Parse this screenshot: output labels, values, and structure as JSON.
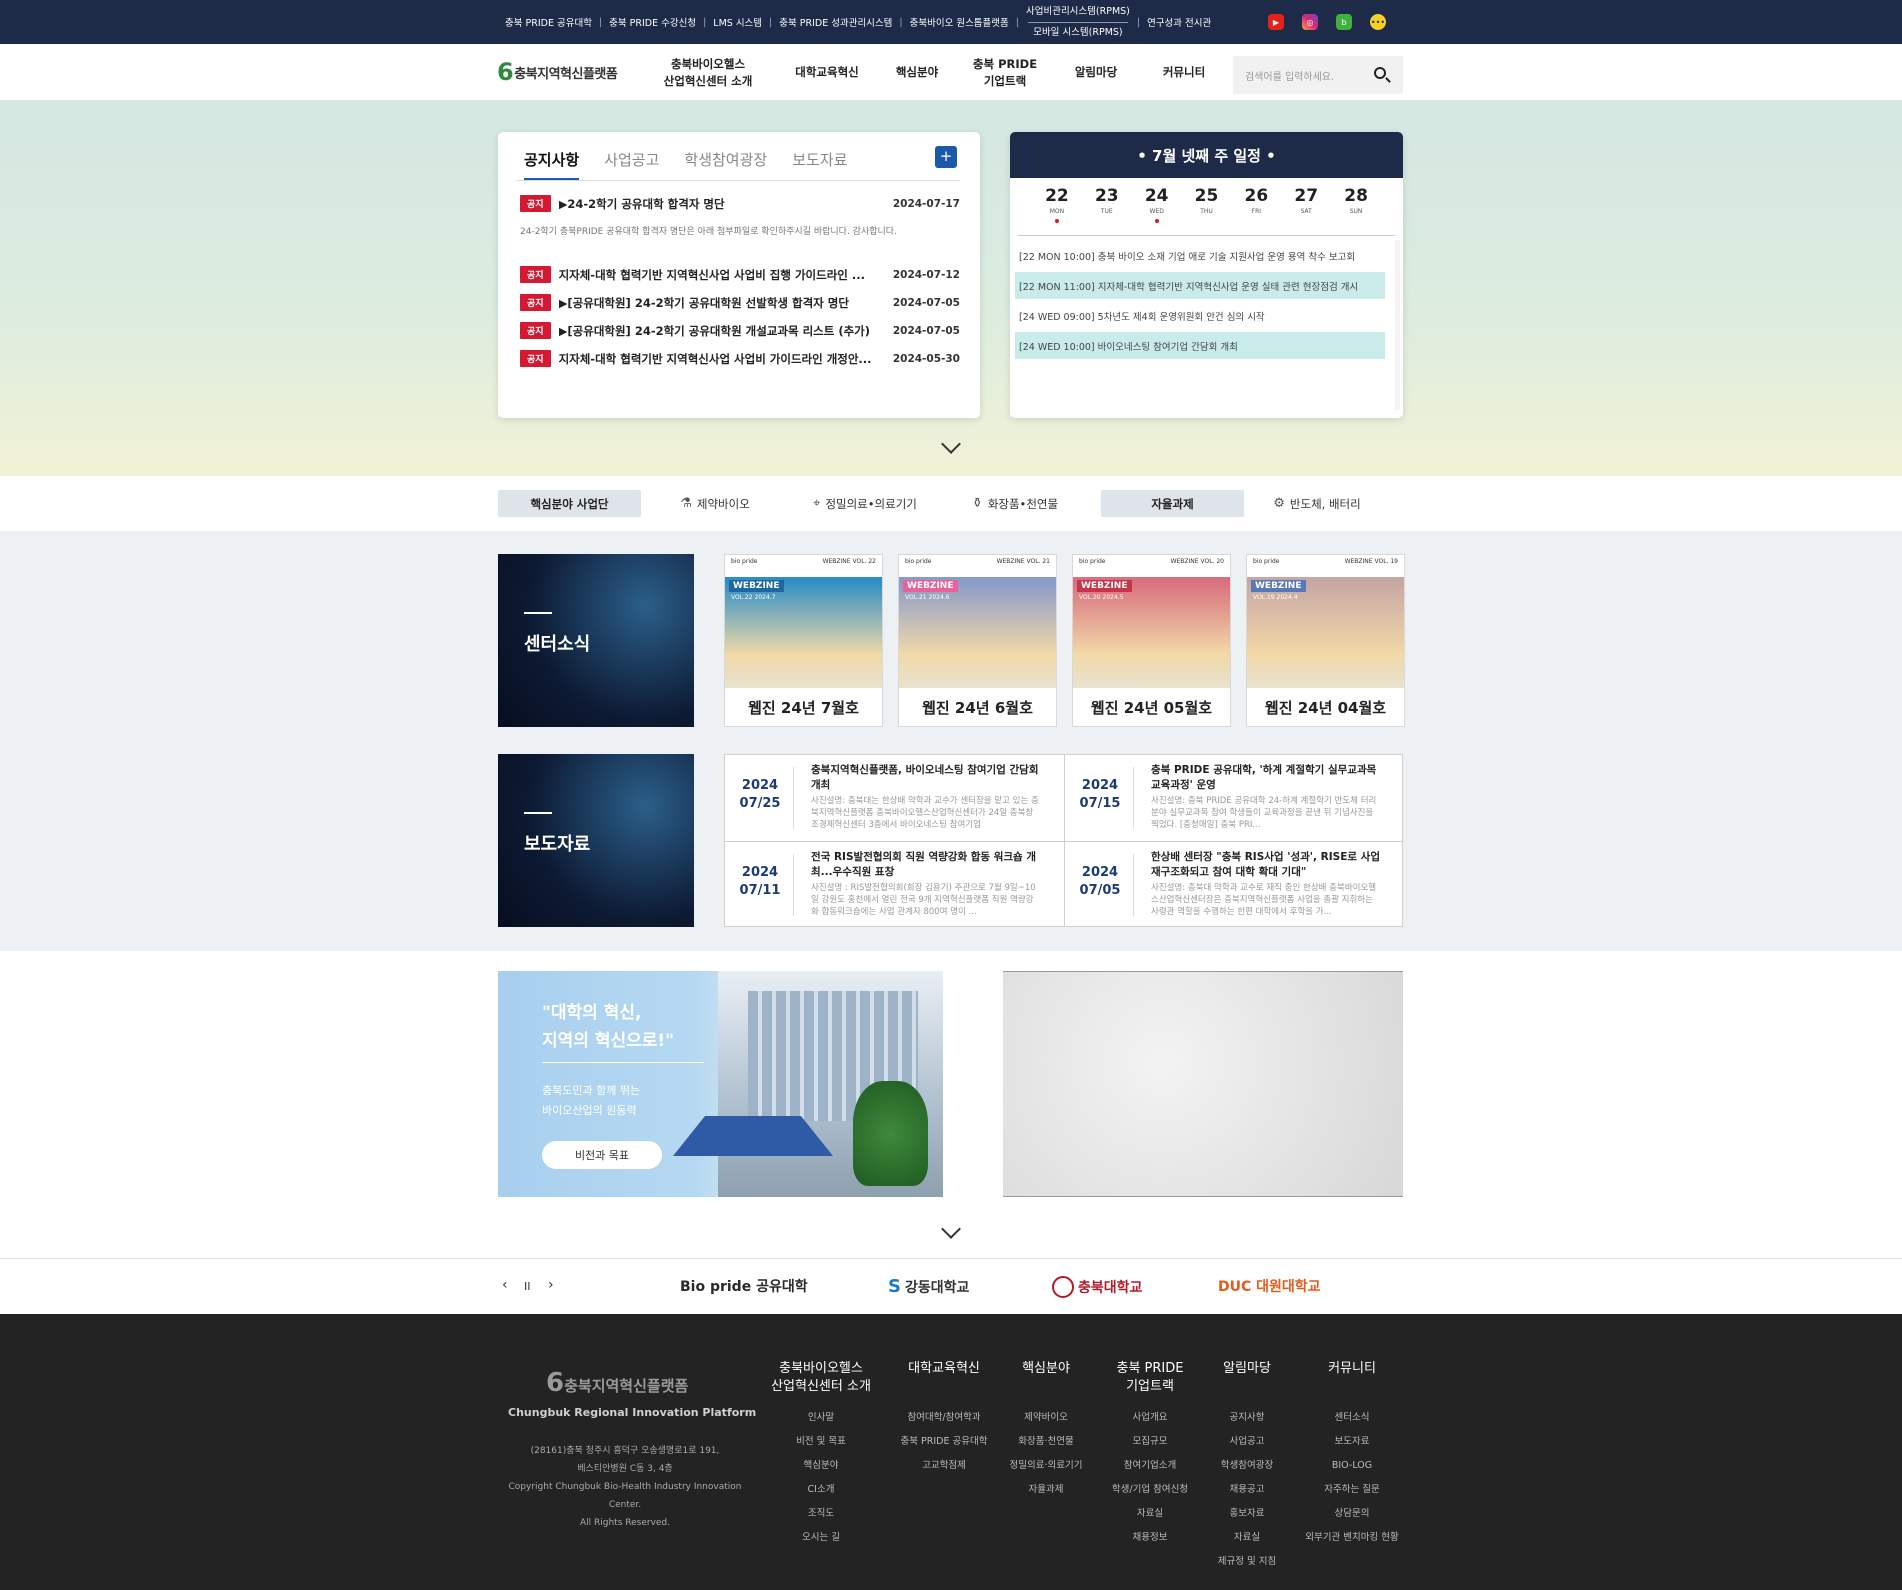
{
  "top_links": {
    "l0": "충북 PRIDE 공유대학",
    "l1": "충북 PRIDE 수강신청",
    "l2": "LMS 시스템",
    "l3": "충북 PRIDE 성과관리시스템",
    "l4": "충북바이오 원스톱플랫폼",
    "l5a": "사업비관리시스템(RPMS)",
    "l5b": "모바일 시스템(RPMS)",
    "l6": "연구성과 전시관"
  },
  "sns_icons": [
    "youtube-icon",
    "instagram-icon",
    "blog-icon",
    "kakao-icon"
  ],
  "logo": "충북지역혁신플랫폼",
  "menu": {
    "m1a": "충북바이오헬스",
    "m1b": "산업혁신센터 소개",
    "m2": "대학교육혁신",
    "m3": "핵심분야",
    "m4a": "충북 PRIDE",
    "m4b": "기업트랙",
    "m5": "알림마당",
    "m6": "커뮤니티"
  },
  "search": {
    "placeholder": "검색어를 입력하세요."
  },
  "notice": {
    "tabs": {
      "t1": "공지사항",
      "t2": "사업공고",
      "t3": "학생참여광장",
      "t4": "보도자료"
    },
    "more": "+",
    "badge": "공지",
    "items": [
      {
        "title": "▶24-2학기 공유대학 합격자 명단",
        "date": "2024-07-17"
      },
      {
        "title": "지자체-대학 협력기반 지역혁신사업 사업비 집행 가이드라인 ...",
        "date": "2024-07-12"
      },
      {
        "title": "▶[공유대학원] 24-2학기 공유대학원 선발학생 합격자 명단",
        "date": "2024-07-05"
      },
      {
        "title": "▶[공유대학원] 24-2학기 공유대학원 개설교과목 리스트 (추가)",
        "date": "2024-07-05"
      },
      {
        "title": "지자체-대학 협력기반 지역혁신사업 사업비 가이드라인 개정안...",
        "date": "2024-05-30"
      }
    ],
    "first_desc": "24-2학기 충북PRIDE 공유대학 합격자 명단은 아래 첨부파일로 확인하주시길 바랍니다. 감사합니다."
  },
  "schedule": {
    "title": "•    7월 넷째 주 일정    •",
    "days": [
      {
        "n": "22",
        "w": "MON",
        "dot": true
      },
      {
        "n": "23",
        "w": "TUE",
        "dot": false
      },
      {
        "n": "24",
        "w": "WED",
        "dot": true
      },
      {
        "n": "25",
        "w": "THU",
        "dot": false
      },
      {
        "n": "26",
        "w": "FRI",
        "dot": false
      },
      {
        "n": "27",
        "w": "SAT",
        "dot": false
      },
      {
        "n": "28",
        "w": "SUN",
        "dot": false
      }
    ],
    "events": [
      {
        "text": "[22 MON 10:00] 충북 바이오 소재 기업 애로 기술 지원사업 운영 용역 착수 보고회",
        "hl": false
      },
      {
        "text": "[22 MON 11:00] 지자체-대학 협력기반 지역혁신사업 운영 실태 관련 현장점검 개시",
        "hl": true
      },
      {
        "text": "[24 WED 09:00] 5차년도 제4회 운영위원회 안건 심의 시작",
        "hl": false
      },
      {
        "text": "[24 WED 10:00] 바이오네스팅 참여기업 간담회 개최",
        "hl": true
      }
    ]
  },
  "biz": {
    "b0": "핵심분야 사업단",
    "b1": "제약바이오",
    "b2": "정밀의료•의료기기",
    "b3": "화장품•천연물",
    "b4": "자율과제",
    "b5": "반도체, 배터리"
  },
  "center_news": "센터소식",
  "press_title": "보도자료",
  "webzines": [
    {
      "caption": "웹진 24년 7월호",
      "tag": "WEBZINE",
      "vol": "VOL.22 2024.7",
      "num": "WEBZINE VOL. 22",
      "color": "#2f8fc4",
      "tagc": "#1f66a5"
    },
    {
      "caption": "웹진 24년 6월호",
      "tag": "WEBZINE",
      "vol": "VOL.21 2024.6",
      "num": "WEBZINE VOL. 21",
      "color": "#8a9bc7",
      "tagc": "#e7629b"
    },
    {
      "caption": "웹진 24년 05월호",
      "tag": "WEBZINE",
      "vol": "VOL.20 2024.5",
      "num": "WEBZINE VOL. 20",
      "color": "#d9707f",
      "tagc": "#c7354d"
    },
    {
      "caption": "웹진 24년 04월호",
      "tag": "WEBZINE",
      "vol": "VOL.19 2024.4",
      "num": "WEBZINE VOL. 19",
      "color": "#c6a7a4",
      "tagc": "#5a78b8"
    }
  ],
  "press": [
    {
      "y": "2024",
      "md": "07/25",
      "title": "충북지역혁신플랫폼, 바이오네스팅 참여기업 간담회 개최",
      "desc": "사진설명: 충북대는 한상배 약학과 교수가 센터장을 맡고 있는 충북지역혁신플랫폼 충북바이오헬스산업혁신센터가 24일 충북창조경제혁신센터 3층에서 바이오네스팅 참여기업"
    },
    {
      "y": "2024",
      "md": "07/15",
      "title": "충북 PRIDE 공유대학, '하계 계절학기 실무교과목 교육과정' 운영",
      "desc": "사진설명: 충북 PRIDE 공유대학 24-하계 계절학기 반도체 터리 분야 실무교과목 참여 학생들이 교육과정을 끝낸 뒤 기념사진을 찍었다. [충청매일] 충북 PRI..."
    },
    {
      "y": "2024",
      "md": "07/11",
      "title": "전국 RIS발전협의회 직원 역량강화 합동 워크숍 개최...우수직원 표창",
      "desc": "사진설명 : RIS발전협의회(회장 김용기) 주관으로 7월 9일~10일 강원도 홍천에서 열린 전국 9개 지역혁신플랫폼 직원 역량강화 합동워크숍에는 사업 관계자 800여 명이 ..."
    },
    {
      "y": "2024",
      "md": "07/05",
      "title": "한상배 센터장 \"충북 RIS사업 '성과', RISE로 사업 재구조화되고 참여 대학 확대 기대\"",
      "desc": "사진설명: 충북대 약학과 교수로 재직 중인 한상배 충북바이오헬스산업혁신센터장은 충북지역혁신플랫폼 사업을 총괄 지휘하는 사령관 역할을 수행하는 한편 대학에서 후학을 가..."
    }
  ],
  "vision": {
    "q1": "\"대학의 혁신,",
    "q2": "지역의 혁신으로!\"",
    "s1": "충북도민과 함께 뛰는",
    "s2": "바이오산업의 원동력",
    "btn": "비전과 목표"
  },
  "partners": {
    "prev": "‹",
    "pause": "II",
    "next": "›",
    "p1": "Bio pride 공유대학",
    "p2": "강동대학교",
    "p3": "충북대학교",
    "p4": "DUC 대원대학교"
  },
  "footer": {
    "logo": "충북지역혁신플랫폼",
    "en": "Chungbuk Regional Innovation Platform",
    "addr1": "(28161)충북 청주시 흥덕구 오송생명로1로 191,",
    "addr2": "베스티안병원 C동 3, 4층",
    "addr3": "Copyright Chungbuk Bio-Health Industry Innovation",
    "addr4": "Center.",
    "addr5": "All Rights Reserved.",
    "cols": [
      {
        "h1": "충북바이오헬스",
        "h2": "산업혁신센터 소개",
        "items": [
          "인사말",
          "비전 및 목표",
          "핵심분야",
          "CI소개",
          "조직도",
          "오시는 길"
        ]
      },
      {
        "h1": "대학교육혁신",
        "h2": "",
        "items": [
          "참여대학/참여학과",
          "충북 PRIDE 공유대학",
          "고교학점제"
        ]
      },
      {
        "h1": "핵심분야",
        "h2": "",
        "items": [
          "제약바이오",
          "화장품·천연물",
          "정밀의료·의료기기",
          "자율과제"
        ]
      },
      {
        "h1": "충북 PRIDE",
        "h2": "기업트랙",
        "items": [
          "사업개요",
          "모집규모",
          "참여기업소개",
          "학생/기업 참여신청",
          "자료실",
          "채용정보"
        ]
      },
      {
        "h1": "알림마당",
        "h2": "",
        "items": [
          "공지사항",
          "사업공고",
          "학생참여광장",
          "채용공고",
          "홍보자료",
          "자료실",
          "제규정 및 지침"
        ]
      },
      {
        "h1": "커뮤니티",
        "h2": "",
        "items": [
          "센터소식",
          "보도자료",
          "BIO-LOG",
          "자주하는 질문",
          "상담문의",
          "외부기관 벤치마킹 현황"
        ]
      }
    ]
  }
}
